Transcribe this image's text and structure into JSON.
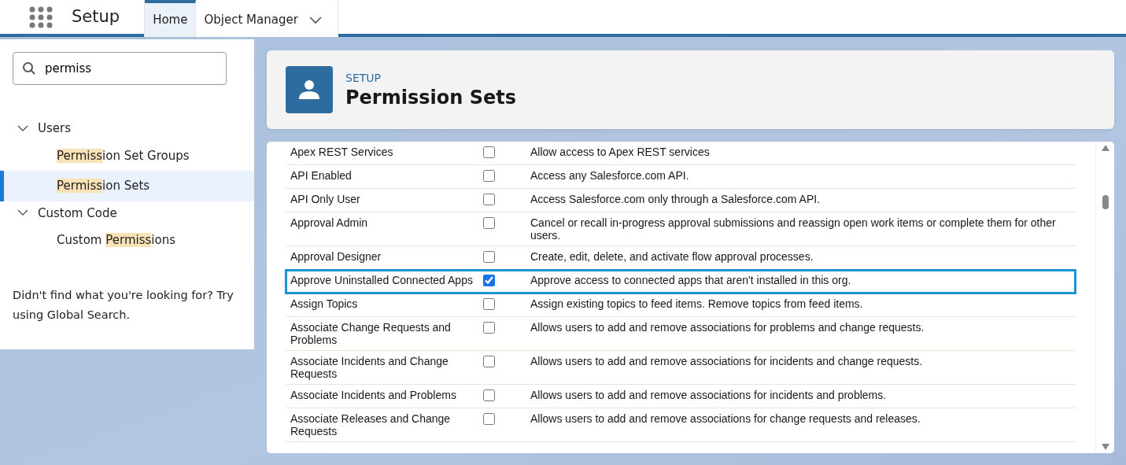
{
  "app": {
    "title": "Setup"
  },
  "tabs": [
    {
      "label": "Home",
      "selected": true,
      "dropdown": false
    },
    {
      "label": "Object Manager",
      "selected": false,
      "dropdown": true
    }
  ],
  "search": {
    "value": "permiss"
  },
  "sidebar": {
    "items": [
      {
        "label": "Users",
        "expanded": true,
        "children": [
          {
            "match": "Permiss",
            "after": "ion Set Groups",
            "selected": false
          },
          {
            "match": "Permiss",
            "after": "ion Sets",
            "selected": true
          }
        ]
      },
      {
        "label": "Custom Code",
        "expanded": true,
        "children": [
          {
            "before": "Custom ",
            "match": "Permiss",
            "after": "ions",
            "selected": false
          }
        ]
      }
    ],
    "hint": "Didn't find what you're looking for? Try using Global Search."
  },
  "page_header": {
    "eyebrow": "SETUP",
    "title": "Permission Sets"
  },
  "table": {
    "rows": [
      {
        "name": "Apex REST Services",
        "checked": false,
        "description": "Allow access to Apex REST services",
        "selected": false
      },
      {
        "name": "API Enabled",
        "checked": false,
        "description": "Access any Salesforce.com API.",
        "selected": false
      },
      {
        "name": "API Only User",
        "checked": false,
        "description": "Access Salesforce.com only through a Salesforce.com API.",
        "selected": false
      },
      {
        "name": "Approval Admin",
        "checked": false,
        "description": "Cancel or recall in-progress approval submissions and reassign open work items or complete them for other users.",
        "selected": false
      },
      {
        "name": "Approval Designer",
        "checked": false,
        "description": "Create, edit, delete, and activate flow approval processes.",
        "selected": false
      },
      {
        "name": "Approve Uninstalled Connected Apps",
        "checked": true,
        "description": "Approve access to connected apps that aren't installed in this org.",
        "selected": true
      },
      {
        "name": "Assign Topics",
        "checked": false,
        "description": "Assign existing topics to feed items. Remove topics from feed items.",
        "selected": false
      },
      {
        "name": "Associate Change Requests and Problems",
        "checked": false,
        "description": "Allows users to add and remove associations for problems and change requests.",
        "selected": false
      },
      {
        "name": "Associate Incidents and Change Requests",
        "checked": false,
        "description": "Allows users to add and remove associations for incidents and change requests.",
        "selected": false
      },
      {
        "name": "Associate Incidents and Problems",
        "checked": false,
        "description": "Allows users to add and remove associations for incidents and problems.",
        "selected": false
      },
      {
        "name": "Associate Releases and Change Requests",
        "checked": false,
        "description": "Allows users to add and remove associations for change requests and releases.",
        "selected": false
      }
    ]
  }
}
